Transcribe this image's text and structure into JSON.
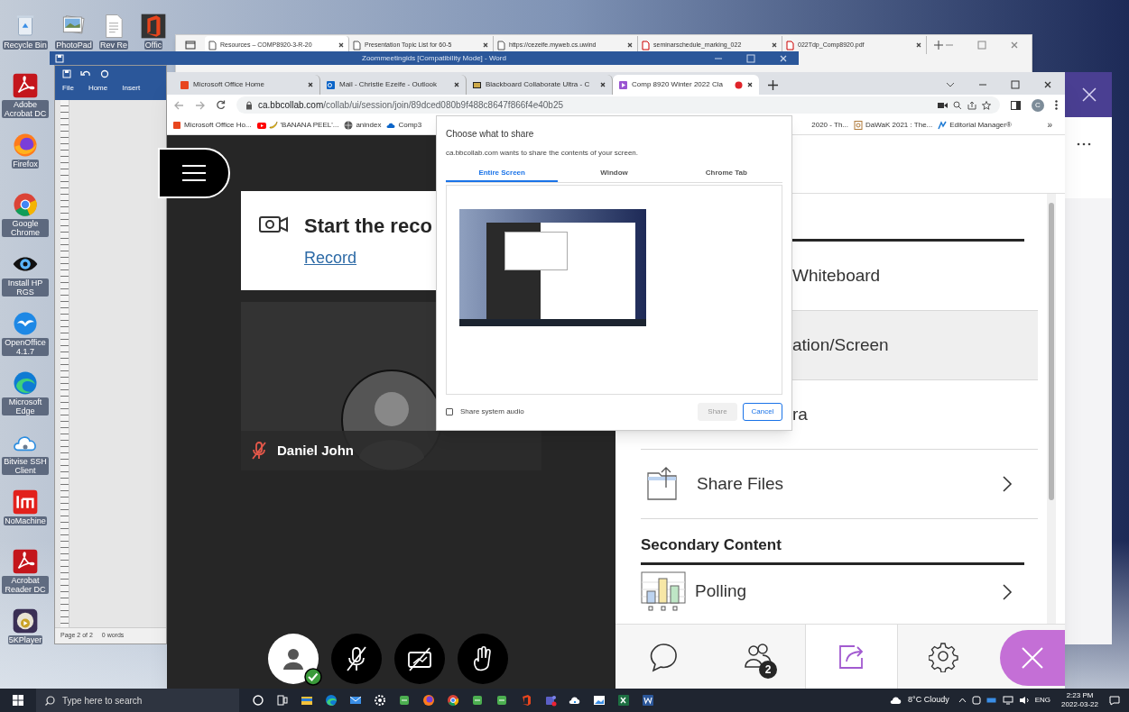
{
  "desktop_icons": [
    {
      "label": "Recycle Bin",
      "kind": "recycle"
    },
    {
      "label": "Adobe Acrobat DC",
      "kind": "acrobat"
    },
    {
      "label": "Firefox",
      "kind": "firefox"
    },
    {
      "label": "Google Chrome",
      "kind": "chrome"
    },
    {
      "label": "Install HP RGS",
      "kind": "eye"
    },
    {
      "label": "OpenOffice 4.1.7",
      "kind": "openoffice"
    },
    {
      "label": "Microsoft Edge",
      "kind": "edge"
    },
    {
      "label": "Bitvise SSH Client",
      "kind": "cloud"
    },
    {
      "label": "NoMachine",
      "kind": "nomachine"
    },
    {
      "label": "Acrobat Reader DC",
      "kind": "acrobat"
    },
    {
      "label": "5KPlayer",
      "kind": "player"
    }
  ],
  "desktop_top_icons": [
    {
      "label": "PhotoPad",
      "kind": "photo"
    },
    {
      "label": "Rev Re",
      "kind": "document"
    },
    {
      "label": "Offic",
      "kind": "office"
    }
  ],
  "edge_window": {
    "tabs": [
      {
        "title": "Resources – COMP8920-3-R-20",
        "selected": true
      },
      {
        "title": "Presentation Topic List for 60-5",
        "selected": false
      },
      {
        "title": "https://cezeife.myweb.cs.uwind",
        "selected": false
      },
      {
        "title": "seminarschedule_marking_022",
        "selected": false
      },
      {
        "title": "022Tdp_Comp8920.pdf",
        "selected": false
      }
    ]
  },
  "word_window": {
    "title": "Zoommeetingids [Compatibility Mode] - Word",
    "ribbon_tabs": [
      "File",
      "Home",
      "Insert"
    ],
    "status": [
      "Page 2 of 2",
      "0 words"
    ]
  },
  "browser": {
    "tabs": [
      {
        "title": "Microsoft Office Home",
        "kind": "office",
        "selected": false,
        "recording": false
      },
      {
        "title": "Mail - Christie Ezeife - Outlook",
        "kind": "outlook",
        "selected": false,
        "recording": false
      },
      {
        "title": "Blackboard Collaborate Ultra - C",
        "kind": "blackboard",
        "selected": false,
        "recording": false
      },
      {
        "title": "Comp 8920 Winter 2022 Cla",
        "kind": "collab",
        "selected": true,
        "recording": true
      }
    ],
    "url_host": "ca.bbcollab.com",
    "url_path": "/collab/ui/session/join/89dced080b9f488c8647f866f4e40b25",
    "profile_initial": "C",
    "bookmarks_left": [
      {
        "label": "Microsoft Office Ho...",
        "kind": "office"
      },
      {
        "label": "'BANANA PEEL'...",
        "kind": "youtube"
      },
      {
        "label": "anindex",
        "kind": "globe"
      },
      {
        "label": "Comp3",
        "kind": "cloud"
      }
    ],
    "bookmarks_right": [
      {
        "label": "2020 - Th...",
        "kind": "none"
      },
      {
        "label": "DaWaK 2021 : The...",
        "kind": "doc"
      },
      {
        "label": "Editorial Manager®",
        "kind": "em"
      }
    ],
    "bookmarks_more": "»"
  },
  "collaborate": {
    "record_card": {
      "title": "Start the reco",
      "link": "Record"
    },
    "participant": {
      "name": "Daniel John",
      "muted": true
    },
    "controls": [
      {
        "kind": "avatar",
        "checked": true
      },
      {
        "kind": "mic_off"
      },
      {
        "kind": "camera_off"
      },
      {
        "kind": "hand"
      }
    ],
    "share_items": [
      {
        "kind": "covered",
        "label": "Whiteboard",
        "selected": false
      },
      {
        "kind": "covered",
        "label": "ation/Screen",
        "selected": true
      },
      {
        "kind": "covered",
        "label": "ra",
        "selected": false
      },
      {
        "kind": "files",
        "label": "Share Files",
        "selected": false
      }
    ],
    "secondary_heading": "Secondary Content",
    "secondary_items": [
      {
        "kind": "polling",
        "label": "Polling"
      }
    ],
    "bottom_tabs": [
      {
        "kind": "chat",
        "selected": false
      },
      {
        "kind": "participants",
        "badge": "2",
        "selected": false
      },
      {
        "kind": "share",
        "selected": true
      },
      {
        "kind": "settings",
        "selected": false
      }
    ]
  },
  "share_dialog": {
    "title": "Choose what to share",
    "message": "ca.bbcollab.com wants to share the contents of your screen.",
    "tabs": [
      {
        "label": "Entire Screen",
        "selected": true
      },
      {
        "label": "Window",
        "selected": false
      },
      {
        "label": "Chrome Tab",
        "selected": false
      }
    ],
    "audio": {
      "label": "Share system audio",
      "checked": false
    },
    "buttons": [
      {
        "label": "Share",
        "kind": "disabled"
      },
      {
        "label": "Cancel",
        "kind": "primary"
      }
    ]
  },
  "taskbar": {
    "search_placeholder": "Type here to search",
    "apps": [
      {
        "kind": "cortana"
      },
      {
        "kind": "taskview"
      },
      {
        "kind": "explorer"
      },
      {
        "kind": "edge"
      },
      {
        "kind": "mail"
      },
      {
        "kind": "settings"
      },
      {
        "kind": "app"
      },
      {
        "kind": "firefox"
      },
      {
        "kind": "chrome"
      },
      {
        "kind": "app"
      },
      {
        "kind": "app"
      },
      {
        "kind": "office"
      },
      {
        "kind": "teams"
      },
      {
        "kind": "cloud"
      },
      {
        "kind": "photos"
      },
      {
        "kind": "excel"
      },
      {
        "kind": "word"
      }
    ],
    "weather": "8°C Cloudy",
    "language": "ENG",
    "time": "2:23 PM",
    "date": "2022-03-22"
  }
}
